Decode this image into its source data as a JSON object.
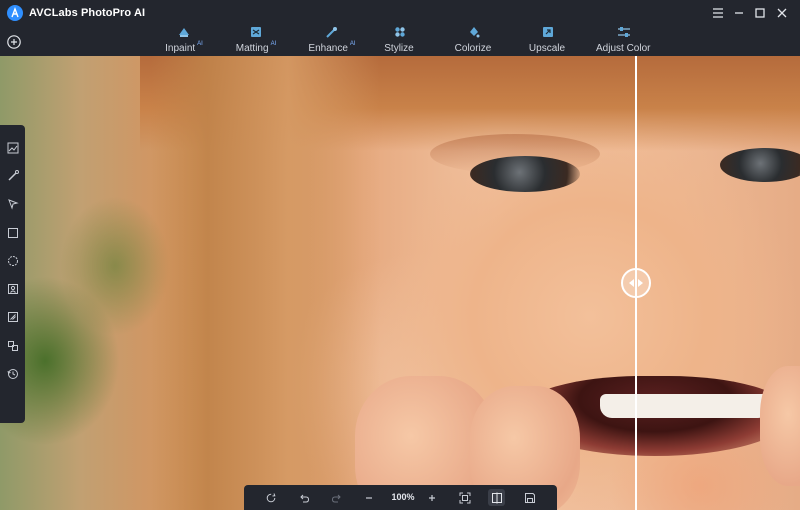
{
  "app": {
    "title": "AVCLabs PhotoPro AI"
  },
  "tabs": [
    {
      "label": "Inpaint",
      "badge": "AI",
      "icon": "inpaint-icon"
    },
    {
      "label": "Matting",
      "badge": "AI",
      "icon": "matting-icon"
    },
    {
      "label": "Enhance",
      "badge": "AI",
      "icon": "enhance-icon"
    },
    {
      "label": "Stylize",
      "badge": "",
      "icon": "stylize-icon"
    },
    {
      "label": "Colorize",
      "badge": "",
      "icon": "colorize-icon"
    },
    {
      "label": "Upscale",
      "badge": "",
      "icon": "upscale-icon"
    },
    {
      "label": "Adjust Color",
      "badge": "",
      "icon": "adjust-color-icon"
    }
  ],
  "window_controls": [
    "menu-icon",
    "minimize-icon",
    "maximize-icon",
    "close-icon"
  ],
  "left_tools": [
    "image-icon",
    "brush-icon",
    "select-pointer-icon",
    "rectangle-select-icon",
    "ellipse-select-icon",
    "portrait-icon",
    "object-select-icon",
    "replace-icon",
    "history-icon"
  ],
  "bottom_bar": {
    "zoom": "100%",
    "tools": [
      "reset-icon",
      "undo-icon",
      "redo-icon",
      "zoom-out-icon",
      "zoom-in-icon",
      "fit-screen-icon",
      "compare-icon",
      "save-icon"
    ]
  },
  "colors": {
    "accent": "#2f8fff",
    "background": "#1c1f26",
    "panel": "#23262e"
  }
}
